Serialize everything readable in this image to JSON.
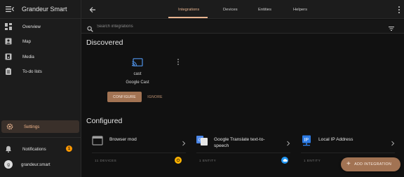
{
  "app": {
    "title": "Grandeur Smart"
  },
  "sidebar": {
    "items": [
      {
        "label": "Overview",
        "icon": "dashboard-icon"
      },
      {
        "label": "Map",
        "icon": "map-icon"
      },
      {
        "label": "Media",
        "icon": "media-icon"
      },
      {
        "label": "To-do lists",
        "icon": "clipboard-icon"
      }
    ],
    "settings_label": "Settings",
    "notifications_label": "Notifications",
    "notifications_count": "1",
    "user_initial": "g",
    "user_name": "grandeur.smart"
  },
  "topbar": {
    "tabs": [
      {
        "label": "Integrations",
        "active": true
      },
      {
        "label": "Devices",
        "active": false
      },
      {
        "label": "Entities",
        "active": false
      },
      {
        "label": "Helpers",
        "active": false
      }
    ]
  },
  "search": {
    "placeholder": "Search integrations"
  },
  "discovered": {
    "title": "Discovered",
    "items": [
      {
        "domain": "cast",
        "name": "Google Cast",
        "configure_label": "CONFIGURE",
        "ignore_label": "IGNORE"
      }
    ]
  },
  "configured": {
    "title": "Configured",
    "items": [
      {
        "name_line1": "Browser mod",
        "name_line2": "",
        "count": "11 DEVICES",
        "badge_color": "#ffb300"
      },
      {
        "name_line1": "Google Translate text-to-",
        "name_line2": "speech",
        "count": "1 ENTITY",
        "badge_color": ""
      },
      {
        "name_line1": "Local IP Address",
        "name_line2": "",
        "count": "1 ENTITY",
        "badge_color": "#2196f3"
      }
    ]
  },
  "fab": {
    "label": "ADD INTEGRATION"
  },
  "colors": {
    "accent": "#a27353",
    "accent_text": "#e7b38f",
    "background": "#111111",
    "sidebar": "#1c1c1c"
  }
}
